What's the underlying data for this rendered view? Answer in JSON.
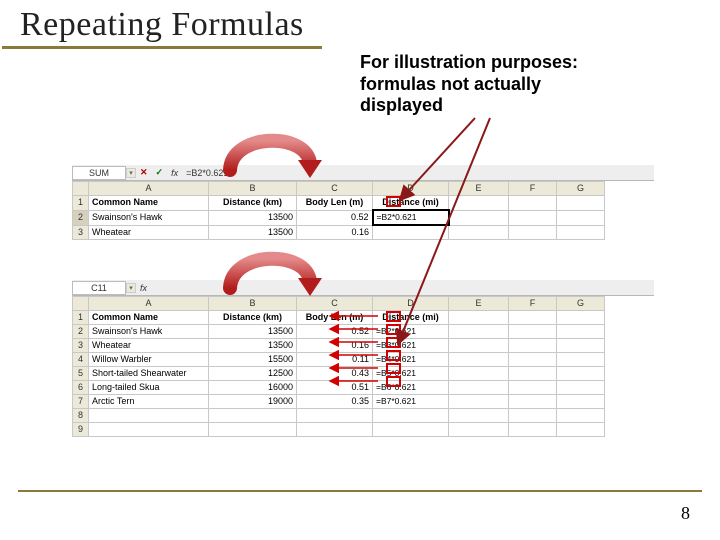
{
  "title": "Repeating Formulas",
  "annotation": "For illustration purposes: formulas not actually displayed",
  "page_number": "8",
  "sheet1": {
    "namebox": "SUM",
    "fx": "=B2*0.621",
    "cancel": "✕",
    "ok": "✓",
    "fx_label": "fx",
    "columns": [
      "",
      "A",
      "B",
      "C",
      "D",
      "E",
      "F",
      "G"
    ],
    "headers": [
      "Common Name",
      "Distance (km)",
      "Body Len (m)",
      "Distance (mi)"
    ],
    "rows": [
      {
        "n": "2",
        "a": "Swainson's Hawk",
        "b": "13500",
        "c": "0.52",
        "d": "=B2*0.621"
      },
      {
        "n": "3",
        "a": "Wheatear",
        "b": "13500",
        "c": "0.16",
        "d": ""
      }
    ]
  },
  "sheet2": {
    "namebox": "C11",
    "fx": "",
    "fx_label": "fx",
    "columns": [
      "",
      "A",
      "B",
      "C",
      "D",
      "E",
      "F",
      "G"
    ],
    "headers": [
      "Common Name",
      "Distance (km)",
      "Body Len (m)",
      "Distance (mi)"
    ],
    "rows": [
      {
        "n": "2",
        "a": "Swainson's Hawk",
        "b": "13500",
        "c": "0.52",
        "d": "=B2*0.621"
      },
      {
        "n": "3",
        "a": "Wheatear",
        "b": "13500",
        "c": "0.16",
        "d": "=B3*0.621"
      },
      {
        "n": "4",
        "a": "Willow Warbler",
        "b": "15500",
        "c": "0.11",
        "d": "=B4*0.621"
      },
      {
        "n": "5",
        "a": "Short-tailed Shearwater",
        "b": "12500",
        "c": "0.43",
        "d": "=B5*0.621"
      },
      {
        "n": "6",
        "a": "Long-tailed Skua",
        "b": "16000",
        "c": "0.51",
        "d": "=B6*0.621"
      },
      {
        "n": "7",
        "a": "Arctic Tern",
        "b": "19000",
        "c": "0.35",
        "d": "=B7*0.621"
      },
      {
        "n": "8",
        "a": "",
        "b": "",
        "c": "",
        "d": ""
      },
      {
        "n": "9",
        "a": "",
        "b": "",
        "c": "",
        "d": ""
      }
    ]
  }
}
